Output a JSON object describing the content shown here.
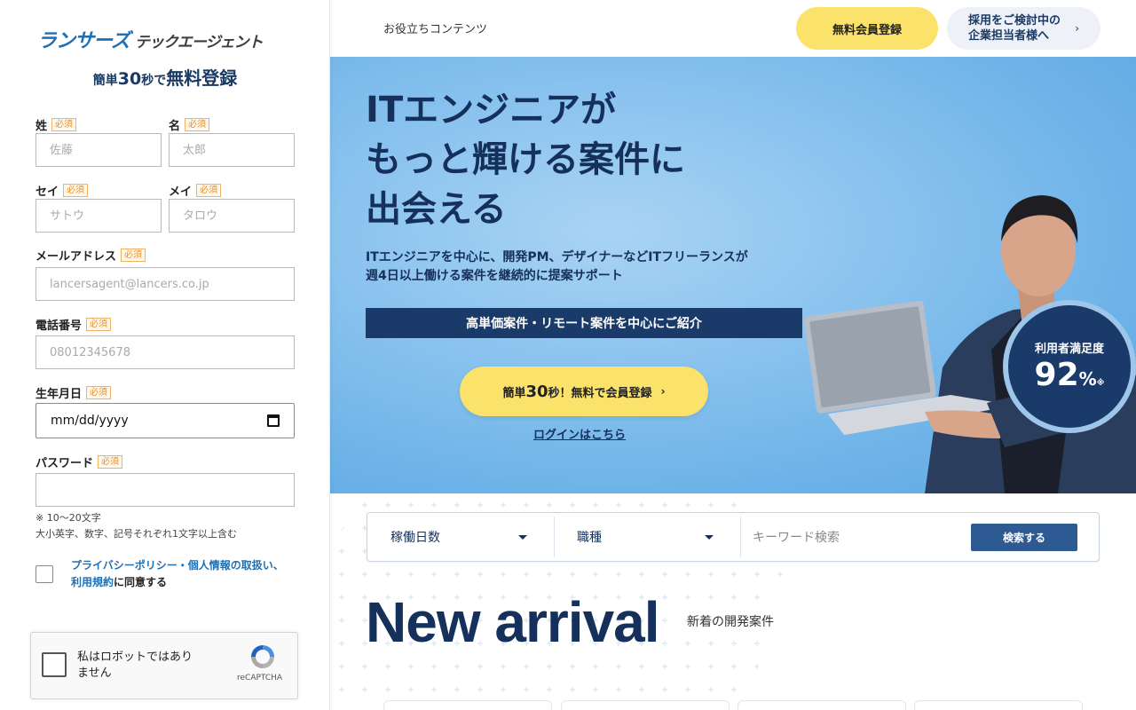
{
  "sidebar": {
    "logo_brand": "ランサーズ",
    "logo_sub": "テックエージェント",
    "tagline_part1": "簡単",
    "tagline_number": "30",
    "tagline_part2": "秒で",
    "tagline_part3": "無料登録",
    "required_label": "必須",
    "fields": {
      "last_name": {
        "label": "姓",
        "placeholder": "佐藤"
      },
      "first_name": {
        "label": "名",
        "placeholder": "太郎"
      },
      "last_kana": {
        "label": "セイ",
        "placeholder": "サトウ"
      },
      "first_kana": {
        "label": "メイ",
        "placeholder": "タロウ"
      },
      "email": {
        "label": "メールアドレス",
        "placeholder": "lancersagent@lancers.co.jp"
      },
      "phone": {
        "label": "電話番号",
        "placeholder": "08012345678"
      },
      "birthday": {
        "label": "生年月日",
        "value": "mm/dd/yyyy"
      },
      "password": {
        "label": "パスワード",
        "placeholder": ""
      }
    },
    "password_note_line1": "※ 10〜20文字",
    "password_note_line2": "大小英字、数字、記号それぞれ1文字以上含む",
    "agree_link1": "プライバシーポリシー・個人情報の取扱い、",
    "agree_link2": "利用規約",
    "agree_suffix": "に同意する",
    "recaptcha": {
      "text_line1": "私はロボットではあり",
      "text_line2": "ません",
      "brand": "reCAPTCHA"
    }
  },
  "header": {
    "nav_link": "お役立ちコンテンツ",
    "register_button": "無料会員登録",
    "corp_button_line1": "採用をご検討中の",
    "corp_button_line2": "企業担当者様へ",
    "chevron_icon": "chevron-right-icon"
  },
  "hero": {
    "headline_line1": "ITエンジニアが",
    "headline_line2": "もっと輝ける案件に",
    "headline_line3": "出会える",
    "desc_line1": "ITエンジニアを中心に、開発PM、デザイナーなどITフリーランスが",
    "desc_line2": "週4日以上働ける案件を継続的に提案サポート",
    "band_text": "高単価案件・リモート案件を中心にご紹介",
    "cta_part1": "簡単",
    "cta_number": "30",
    "cta_part2": "秒！無料で会員登録",
    "login_link": "ログインはこちら",
    "badge_label": "利用者満足度",
    "badge_value": "92",
    "badge_unit": "%",
    "badge_note": "※"
  },
  "search": {
    "select_days": "稼働日数",
    "select_job": "職種",
    "keyword_placeholder": "キーワード検索",
    "button": "検索する"
  },
  "new_arrival": {
    "title": "New arrival",
    "subtitle": "新着の開発案件"
  },
  "colors": {
    "navy": "#15305a",
    "accent_yellow": "#fbe26a",
    "brand_blue": "#1f6fb3",
    "required_orange": "#e8902a"
  }
}
